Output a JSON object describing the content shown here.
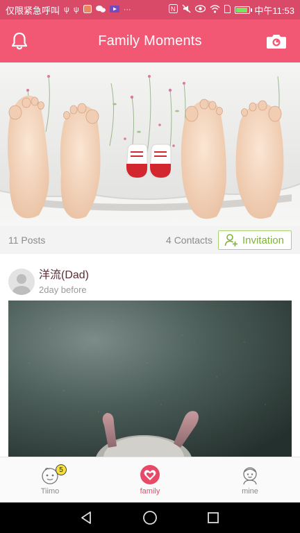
{
  "status_bar": {
    "carrier_text": "仅限紧急呼叫",
    "time": "中午11:53",
    "battery_color": "#7be35f",
    "battery_level": 0.85,
    "left_icons": [
      "usb-icon",
      "usb-icon",
      "app-icon",
      "wechat-icon",
      "video-icon",
      "more-icon"
    ],
    "right_icons": [
      "nfc-icon",
      "mute-icon",
      "eye-icon",
      "wifi-icon",
      "sim-icon",
      "battery-icon"
    ]
  },
  "header": {
    "title": "Family Moments",
    "left_icon": "bell-icon",
    "right_icon": "camera-icon",
    "bg_color": "#f25873"
  },
  "stats": {
    "posts": "11 Posts",
    "contacts": "4 Contacts",
    "invite_label": "Invitation"
  },
  "post": {
    "author": "洋流(Dad)",
    "time": "2day before"
  },
  "tabs": [
    {
      "label": "Tiimo",
      "icon": "baby-face-icon",
      "badge": "5"
    },
    {
      "label": "family",
      "icon": "family-heart-icon",
      "active": true
    },
    {
      "label": "mine",
      "icon": "child-face-icon"
    }
  ]
}
